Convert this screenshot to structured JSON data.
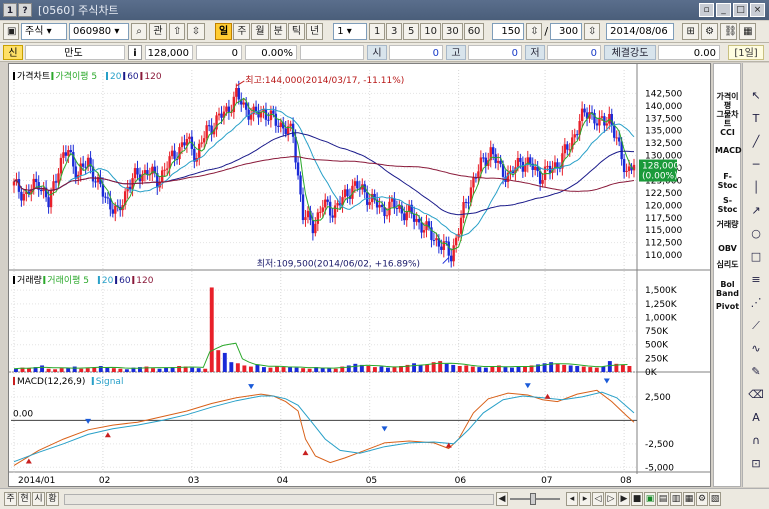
{
  "window": {
    "number": "1",
    "help": "?",
    "title": "[0560] 주식차트",
    "controls": [
      "▫",
      "_",
      "□",
      "×"
    ]
  },
  "toolbar": {
    "market": "주식",
    "code": "060980",
    "extra": "관",
    "period_buttons": [
      {
        "label": "일",
        "active": true
      },
      {
        "label": "주",
        "active": false
      },
      {
        "label": "월",
        "active": false
      },
      {
        "label": "분",
        "active": false
      },
      {
        "label": "틱",
        "active": false
      },
      {
        "label": "년",
        "active": false
      }
    ],
    "interval_value": "1",
    "interval_buttons": [
      "1",
      "3",
      "5",
      "10",
      "30",
      "60"
    ],
    "count": "150",
    "total": "300",
    "date": "2014/08/06"
  },
  "infobar": {
    "tag": "신",
    "name": "만도",
    "price": "128,000",
    "change": "0",
    "change_rate": "0.00%",
    "labels": [
      "시",
      "고",
      "저"
    ],
    "values": [
      "0",
      "0",
      "0"
    ],
    "strength_label": "체결강도",
    "strength": "0.00",
    "period_tag": "[1일]"
  },
  "chart": {
    "price_legend": {
      "title": "가격차트",
      "ma": "가격이평 5",
      "p20": "20",
      "p60": "60",
      "p120": "120"
    },
    "volume_legend": {
      "title": "거래량",
      "ma": "거래이평 5",
      "p20": "20",
      "p60": "60",
      "p120": "120"
    },
    "macd_legend": {
      "title": "MACD(12,26,9)",
      "signal": "Signal"
    },
    "high_annotation": "최고:144,000(2014/03/17, -11.11%)",
    "low_annotation": "최저:109,500(2014/06/02, +16.89%)",
    "current_price": "128,000",
    "current_rate": "(0.00%)",
    "macd_zero_label": "0.00",
    "month_labels": [
      "2014/01",
      "02",
      "03",
      "04",
      "05",
      "06",
      "07",
      "08"
    ]
  },
  "chart_data": {
    "type": "candlestick",
    "price_axis": {
      "ticks": [
        "142,500",
        "140,000",
        "137,500",
        "135,000",
        "132,500",
        "130,000",
        "127,500",
        "125,000",
        "122,500",
        "120,000",
        "117,500",
        "115,000",
        "112,500",
        "110,000"
      ],
      "range": [
        107000,
        146000
      ]
    },
    "volume_axis": {
      "ticks": [
        "1,500K",
        "1,250K",
        "1,000K",
        "750K",
        "500K",
        "250K",
        "0K"
      ],
      "range": [
        0,
        1650
      ]
    },
    "macd_axis": {
      "ticks": [
        "2,500",
        "0",
        "-2,500",
        "-5,000"
      ],
      "range": [
        -5500,
        4300
      ]
    },
    "price_path": [
      [
        0,
        124
      ],
      [
        5,
        122
      ],
      [
        10,
        125
      ],
      [
        14,
        120
      ],
      [
        18,
        128
      ],
      [
        22,
        131
      ],
      [
        26,
        126
      ],
      [
        30,
        129
      ],
      [
        34,
        124
      ],
      [
        38,
        121
      ],
      [
        42,
        118
      ],
      [
        46,
        124
      ],
      [
        50,
        126
      ],
      [
        54,
        127
      ],
      [
        58,
        125
      ],
      [
        62,
        128
      ],
      [
        66,
        131
      ],
      [
        70,
        133
      ],
      [
        74,
        130
      ],
      [
        78,
        135
      ],
      [
        82,
        137
      ],
      [
        86,
        139
      ],
      [
        90,
        142
      ],
      [
        93,
        140
      ],
      [
        97,
        138
      ],
      [
        101,
        139
      ],
      [
        105,
        137
      ],
      [
        109,
        136
      ],
      [
        113,
        134
      ],
      [
        117,
        118
      ],
      [
        121,
        116
      ],
      [
        125,
        120
      ],
      [
        129,
        119
      ],
      [
        133,
        121
      ],
      [
        137,
        124
      ],
      [
        141,
        123
      ],
      [
        145,
        121
      ],
      [
        149,
        119
      ],
      [
        153,
        120
      ],
      [
        157,
        119
      ],
      [
        161,
        118
      ],
      [
        165,
        116
      ],
      [
        169,
        114
      ],
      [
        173,
        112
      ],
      [
        177,
        110
      ],
      [
        181,
        117
      ],
      [
        185,
        124
      ],
      [
        189,
        128
      ],
      [
        193,
        131
      ],
      [
        197,
        127
      ],
      [
        201,
        126
      ],
      [
        205,
        129
      ],
      [
        209,
        128
      ],
      [
        213,
        126
      ],
      [
        217,
        127
      ],
      [
        221,
        129
      ],
      [
        225,
        132
      ],
      [
        229,
        137
      ],
      [
        233,
        139
      ],
      [
        237,
        136
      ],
      [
        241,
        138
      ],
      [
        245,
        131
      ],
      [
        248,
        127
      ],
      [
        251,
        128
      ]
    ],
    "volume": [
      60,
      80,
      70,
      90,
      120,
      60,
      50,
      70,
      80,
      100,
      60,
      70,
      90,
      110,
      80,
      70,
      60,
      50,
      80,
      90,
      100,
      70,
      60,
      80,
      90,
      110,
      100,
      80,
      70,
      60,
      1550,
      400,
      350,
      180,
      160,
      120,
      100,
      140,
      90,
      80,
      110,
      90,
      100,
      80,
      70,
      60,
      90,
      80,
      70,
      60,
      100,
      120,
      150,
      130,
      110,
      90,
      100,
      80,
      90,
      110,
      130,
      160,
      120,
      140,
      180,
      200,
      150,
      130,
      110,
      120,
      100,
      90,
      80,
      110,
      120,
      90,
      80,
      100,
      110,
      120,
      140,
      160,
      180,
      150,
      130,
      120,
      110,
      100,
      90,
      80,
      100,
      200,
      150,
      130,
      110
    ],
    "macd": [
      [
        0,
        -4800
      ],
      [
        10,
        -3200
      ],
      [
        20,
        -2000
      ],
      [
        30,
        -1000
      ],
      [
        40,
        -500
      ],
      [
        50,
        -200
      ],
      [
        60,
        400
      ],
      [
        70,
        1000
      ],
      [
        80,
        1800
      ],
      [
        90,
        2400
      ],
      [
        100,
        2800
      ],
      [
        105,
        2600
      ],
      [
        110,
        2000
      ],
      [
        115,
        1000
      ],
      [
        118,
        -2000
      ],
      [
        122,
        -3800
      ],
      [
        128,
        -4500
      ],
      [
        134,
        -4000
      ],
      [
        140,
        -3400
      ],
      [
        150,
        -2400
      ],
      [
        160,
        -2200
      ],
      [
        170,
        -2400
      ],
      [
        176,
        -3000
      ],
      [
        180,
        -2000
      ],
      [
        186,
        800
      ],
      [
        192,
        2300
      ],
      [
        200,
        2900
      ],
      [
        208,
        2700
      ],
      [
        214,
        2200
      ],
      [
        220,
        2000
      ],
      [
        228,
        2800
      ],
      [
        236,
        3200
      ],
      [
        242,
        2000
      ],
      [
        248,
        500
      ],
      [
        251,
        -200
      ]
    ],
    "signal": [
      [
        0,
        -4400
      ],
      [
        10,
        -3400
      ],
      [
        20,
        -2500
      ],
      [
        30,
        -1500
      ],
      [
        40,
        -900
      ],
      [
        50,
        -500
      ],
      [
        60,
        0
      ],
      [
        70,
        600
      ],
      [
        80,
        1400
      ],
      [
        90,
        2100
      ],
      [
        100,
        2600
      ],
      [
        105,
        2600
      ],
      [
        110,
        2300
      ],
      [
        115,
        1600
      ],
      [
        120,
        0
      ],
      [
        126,
        -2000
      ],
      [
        132,
        -3200
      ],
      [
        140,
        -3500
      ],
      [
        150,
        -2800
      ],
      [
        160,
        -2400
      ],
      [
        170,
        -2300
      ],
      [
        178,
        -2500
      ],
      [
        184,
        -1000
      ],
      [
        190,
        800
      ],
      [
        198,
        2200
      ],
      [
        206,
        2600
      ],
      [
        214,
        2400
      ],
      [
        222,
        2200
      ],
      [
        230,
        2500
      ],
      [
        238,
        3000
      ],
      [
        244,
        2400
      ],
      [
        251,
        800
      ]
    ]
  },
  "right_indicators": [
    "가격이평",
    "그물차트",
    "CCI",
    "MACD",
    "F-Stoc",
    "S-Stoc",
    "거래량",
    "OBV",
    "심리도",
    "Bol Band",
    "Pivot"
  ],
  "tools": [
    "cursor-icon",
    "text-icon",
    "line-icon",
    "hline-icon",
    "vline-icon",
    "ray-icon",
    "circle-icon",
    "rect-icon",
    "fibo-icon",
    "gann-icon",
    "trend-icon",
    "wave-icon",
    "pencil-icon",
    "eraser-icon",
    "auto-icon",
    "magnet-icon",
    "lock-icon"
  ],
  "bottom": {
    "tabs": [
      "주",
      "현",
      "시",
      "황"
    ]
  }
}
